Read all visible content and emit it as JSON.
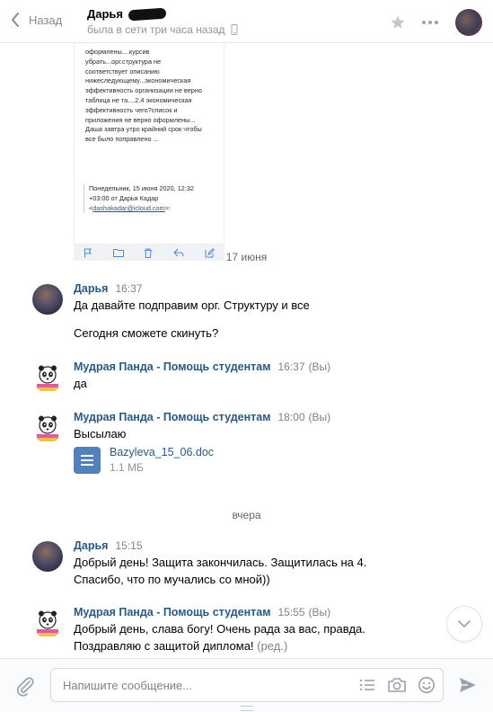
{
  "header": {
    "back_label": "Назад",
    "peer_name": "Дарья",
    "peer_status": "была в сети три часа назад"
  },
  "mail_preview": {
    "lines": "оформлены....курсив\nубрать...орг.структура не\nсоответствует описанию\nнижеследующему...экономическая\nэффективность организации  не верно\nтаблица не та....2.4 экономическая\nэффективность чего?список и\nприложения не верно оформлены...\nДаша завтра утро крайний срок чтобы\nвсе было поправлено ...",
    "signature": "Понедельник, 15 июня 2020, 12:32\n+03:00 от Дарья Кадар\n<",
    "email": "dashakadar@icloud.com",
    "email_tail": ">:"
  },
  "dates": {
    "first": "17 июня",
    "second": "вчера"
  },
  "messages": [
    {
      "author": "Дарья",
      "time": "16:37",
      "you": "",
      "lines": [
        "Да давайте подправим орг. Структуру и все",
        "Сегодня сможете скинуть?"
      ]
    },
    {
      "author": "Мудрая Панда - Помощь студентам",
      "time": "16:37",
      "you": "(Вы)",
      "lines": [
        "да"
      ]
    },
    {
      "author": "Мудрая Панда - Помощь студентам",
      "time": "18:00",
      "you": "(Вы)",
      "lines": [
        "Высылаю"
      ],
      "doc": {
        "name": "Bazyleva_15_06.doc",
        "size": "1.1 МБ"
      }
    },
    {
      "author": "Дарья",
      "time": "15:15",
      "you": "",
      "lines": [
        "Добрый день! Защита закончилась. Защитилась на 4.",
        "Спасибо, что по мучались со мной))"
      ]
    },
    {
      "author": "Мудрая Панда - Помощь студентам",
      "time": "15:55",
      "you": "(Вы)",
      "lines": [
        "Добрый день, слава богу! Очень рада за вас, правда.",
        "Поздравляю с защитой диплома!"
      ],
      "edited": "(ред.)"
    }
  ],
  "composer": {
    "placeholder": "Напишите сообщение..."
  },
  "colors": {
    "link": "#2a5885",
    "accent": "#5181b8",
    "muted": "#828282"
  }
}
